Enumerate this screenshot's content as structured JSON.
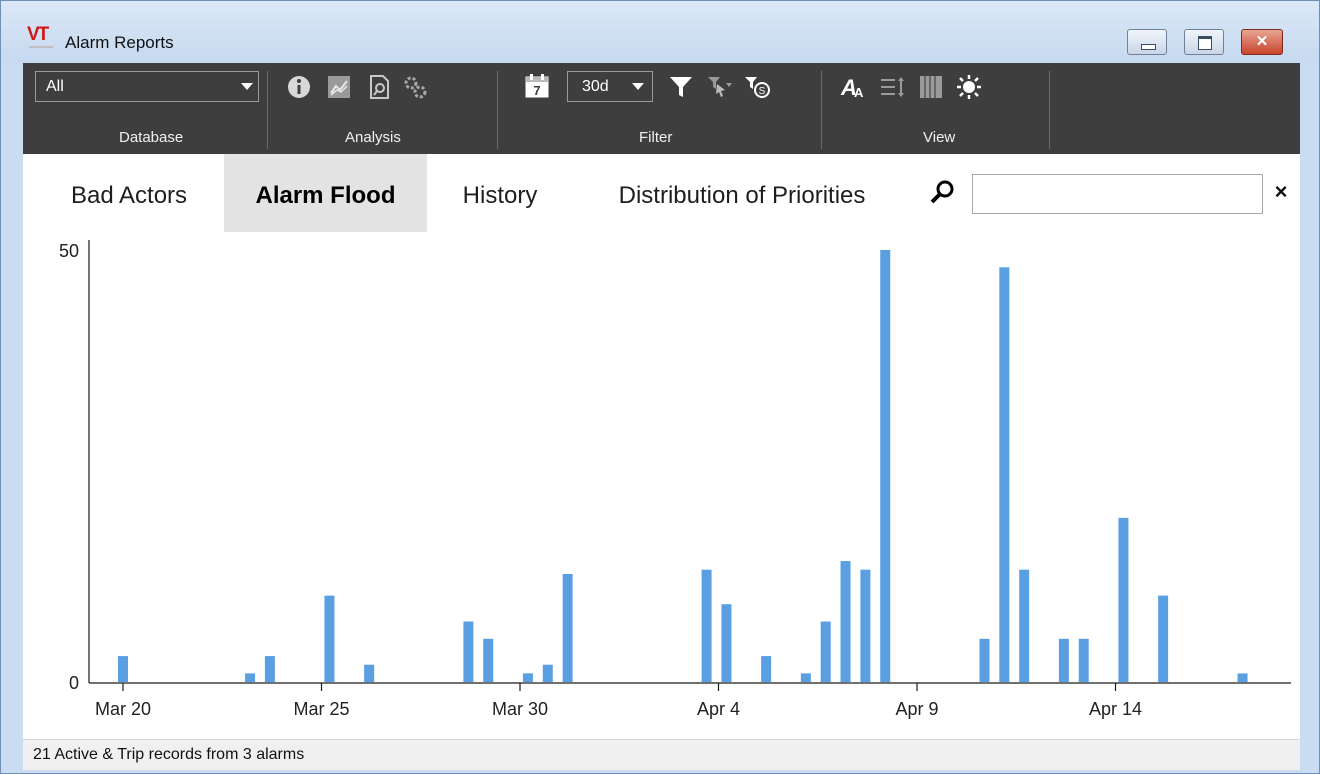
{
  "window": {
    "logo_text": "VT",
    "title": "Alarm Reports",
    "controls": {
      "minimize": "minimize",
      "maximize": "maximize",
      "close": "✕"
    }
  },
  "toolbar": {
    "database": {
      "selected": "All",
      "label": "Database"
    },
    "analysis": {
      "label": "Analysis",
      "icons": [
        "info-icon",
        "trend-chart-icon",
        "report-search-icon",
        "settings-gears-icon"
      ]
    },
    "filter": {
      "range_selected": "30d",
      "label": "Filter",
      "icons": [
        "calendar-icon",
        "filter-icon",
        "filter-select-icon",
        "filter-special-icon"
      ],
      "calendar_day": "7"
    },
    "view": {
      "label": "View",
      "icons": [
        "font-size-icon",
        "row-height-icon",
        "columns-icon",
        "brightness-icon"
      ]
    }
  },
  "tabs": [
    {
      "label": "Bad Actors",
      "active": false
    },
    {
      "label": "Alarm Flood",
      "active": true
    },
    {
      "label": "History",
      "active": false
    },
    {
      "label": "Distribution of Priorities",
      "active": false
    }
  ],
  "search": {
    "value": "",
    "placeholder": "",
    "clear_label": "×"
  },
  "chart_data": {
    "type": "bar",
    "title": "",
    "xlabel": "",
    "ylabel": "",
    "ylim": [
      0,
      50
    ],
    "yticks": [
      0,
      50
    ],
    "xticks": [
      "Mar 20",
      "Mar 25",
      "Mar 30",
      "Apr 4",
      "Apr 9",
      "Apr 14"
    ],
    "bar_color": "#5b9fe3",
    "x_unit_per_tick": 5,
    "x_range": [
      -0.3,
      29.5
    ],
    "bars": [
      {
        "x": 0.0,
        "value": 3
      },
      {
        "x": 3.2,
        "value": 1
      },
      {
        "x": 3.7,
        "value": 3
      },
      {
        "x": 5.2,
        "value": 10
      },
      {
        "x": 6.2,
        "value": 2
      },
      {
        "x": 8.7,
        "value": 7
      },
      {
        "x": 9.2,
        "value": 5
      },
      {
        "x": 10.2,
        "value": 1
      },
      {
        "x": 10.7,
        "value": 2
      },
      {
        "x": 11.2,
        "value": 12.5
      },
      {
        "x": 14.7,
        "value": 13
      },
      {
        "x": 15.2,
        "value": 9
      },
      {
        "x": 16.2,
        "value": 3
      },
      {
        "x": 17.2,
        "value": 1
      },
      {
        "x": 17.7,
        "value": 7
      },
      {
        "x": 18.2,
        "value": 14
      },
      {
        "x": 18.7,
        "value": 13
      },
      {
        "x": 19.2,
        "value": 50
      },
      {
        "x": 21.7,
        "value": 5
      },
      {
        "x": 22.2,
        "value": 48
      },
      {
        "x": 22.7,
        "value": 13
      },
      {
        "x": 23.7,
        "value": 5
      },
      {
        "x": 24.2,
        "value": 5
      },
      {
        "x": 25.2,
        "value": 19
      },
      {
        "x": 26.2,
        "value": 10
      },
      {
        "x": 28.2,
        "value": 1
      }
    ]
  },
  "status": {
    "text": "21 Active & Trip records from 3 alarms"
  }
}
